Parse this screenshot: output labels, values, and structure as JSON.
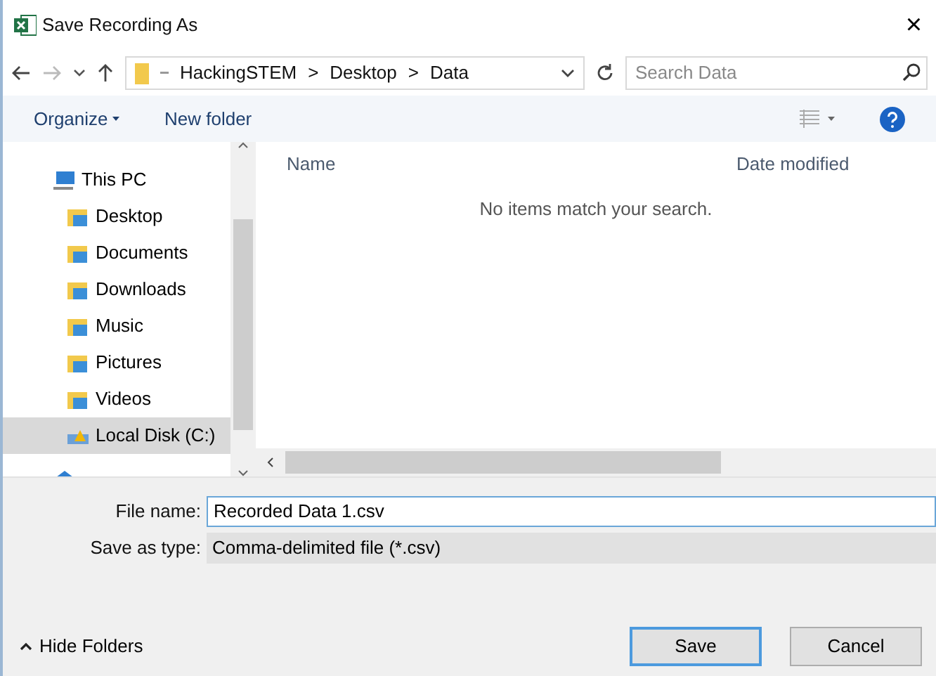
{
  "window": {
    "title": "Save Recording As",
    "close": "×"
  },
  "address_bar": {
    "path": [
      {
        "label": "HackingSTEM"
      },
      {
        "label": "Desktop"
      },
      {
        "label": "Data"
      }
    ],
    "separator": ">"
  },
  "search": {
    "placeholder": "Search Data"
  },
  "toolbar": {
    "organize": "Organize",
    "new_folder": "New folder"
  },
  "sidebar": {
    "items": [
      {
        "label": "This PC",
        "kind": "pc",
        "selected": false
      },
      {
        "label": "Desktop",
        "kind": "folder",
        "selected": false
      },
      {
        "label": "Documents",
        "kind": "folder",
        "selected": false
      },
      {
        "label": "Downloads",
        "kind": "folder",
        "selected": false
      },
      {
        "label": "Music",
        "kind": "folder",
        "selected": false
      },
      {
        "label": "Pictures",
        "kind": "folder",
        "selected": false
      },
      {
        "label": "Videos",
        "kind": "folder",
        "selected": false
      },
      {
        "label": "Local Disk (C:)",
        "kind": "disk",
        "selected": true
      },
      {
        "kind": "network",
        "selected": false
      }
    ]
  },
  "file_list": {
    "columns": [
      "Name",
      "Date modified"
    ],
    "empty_message": "No items match your search."
  },
  "form": {
    "file_name_label": "File name:",
    "file_name": "Recorded Data 1.csv",
    "type_label": "Save as type:",
    "type": "Comma-delimited file (*.csv)"
  },
  "footer": {
    "hide_folders": "Hide Folders",
    "buttons": [
      {
        "label": "Save",
        "kind": "primary"
      },
      {
        "label": "Cancel",
        "kind": "secondary"
      }
    ]
  }
}
